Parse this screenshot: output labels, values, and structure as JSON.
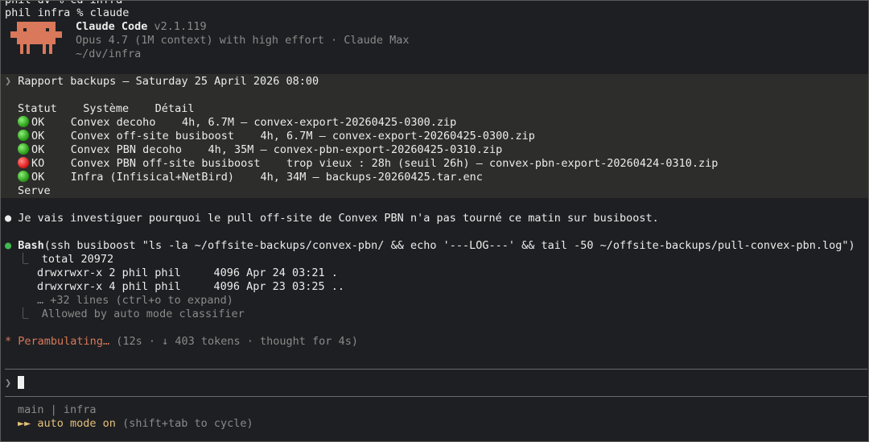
{
  "terminal": {
    "prev_command_cut": "phil dv % cd infra",
    "prompt_line": "phil infra % claude"
  },
  "header": {
    "app_name": "Claude Code",
    "version": "v2.1.119",
    "model_line": "Opus 4.7 (1M context) with high effort · Claude Max",
    "cwd": "~/dv/infra"
  },
  "report": {
    "prompt_marker": "❯",
    "title": "Rapport backups — Saturday 25 April 2026 08:00",
    "columns": "Statut    Système    Détail",
    "rows": [
      {
        "status": "OK",
        "status_kind": "ok",
        "text": "Convex decoho    4h, 6.7M — convex-export-20260425-0300.zip"
      },
      {
        "status": "OK",
        "status_kind": "ok",
        "text": "Convex off-site busiboost    4h, 6.7M — convex-export-20260425-0300.zip"
      },
      {
        "status": "OK",
        "status_kind": "ok",
        "text": "Convex PBN decoho    4h, 35M — convex-pbn-export-20260425-0310.zip"
      },
      {
        "status": "KO",
        "status_kind": "ko",
        "text": "Convex PBN off-site busiboost    trop vieux : 28h (seuil 26h) — convex-pbn-export-20260424-0310.zip"
      },
      {
        "status": "OK",
        "status_kind": "ok",
        "text": "Infra (Infisical+NetBird)    4h, 34M — backups-20260425.tar.enc"
      }
    ],
    "trailing": "Serve"
  },
  "assistant_message": "Je vais investiguer pourquoi le pull off-site de Convex PBN n'a pas tourné ce matin sur busiboost.",
  "tool_call": {
    "name": "Bash",
    "args": "(ssh busiboost \"ls -la ~/offsite-backups/convex-pbn/ && echo '---LOG---' && tail -50 ~/offsite-backups/pull-convex-pbn.log\")",
    "output_lines": [
      "total 20972",
      "drwxrwxr-x 2 phil phil     4096 Apr 24 03:21 .",
      "drwxrwxr-x 4 phil phil     4096 Apr 23 03:25 .."
    ],
    "more": "… +32 lines (ctrl+o to expand)",
    "allowed": "Allowed by auto mode classifier"
  },
  "status": {
    "spinner": "*",
    "verb": "Perambulating…",
    "details": "(12s · ↓ 403 tokens · thought for 4s)"
  },
  "input": {
    "prompt": "❯",
    "value": ""
  },
  "footer": {
    "branch_info": "main | infra",
    "mode_arrows": "►►",
    "mode_label": "auto mode on",
    "mode_hint": "(shift+tab to cycle)"
  },
  "colors": {
    "background": "#1e1f22",
    "accent_orange": "#d9785a",
    "mode_yellow": "#e5c07b",
    "ok_green": "#3fb950",
    "ko_red": "#e02020"
  }
}
